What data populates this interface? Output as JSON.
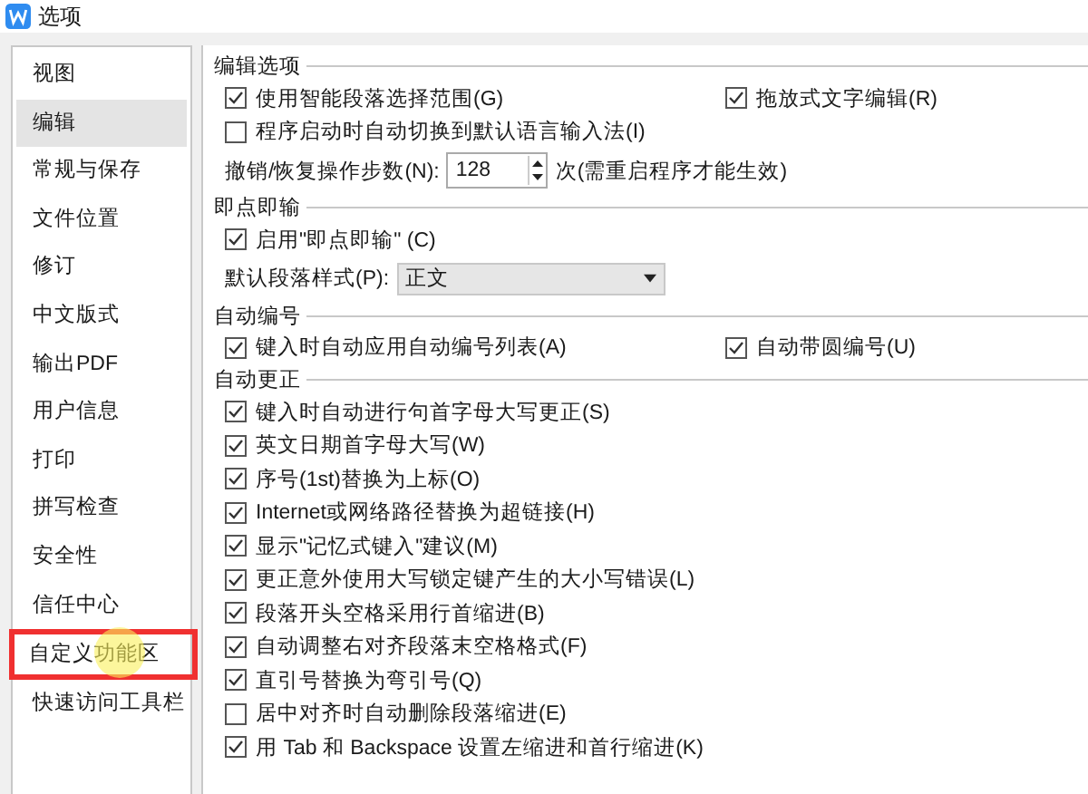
{
  "window": {
    "title": "选项"
  },
  "sidebar": {
    "items": [
      {
        "label": "视图",
        "selected": false,
        "highlighted": false
      },
      {
        "label": "编辑",
        "selected": true,
        "highlighted": false
      },
      {
        "label": "常规与保存",
        "selected": false,
        "highlighted": false
      },
      {
        "label": "文件位置",
        "selected": false,
        "highlighted": false
      },
      {
        "label": "修订",
        "selected": false,
        "highlighted": false
      },
      {
        "label": "中文版式",
        "selected": false,
        "highlighted": false
      },
      {
        "label": "输出PDF",
        "selected": false,
        "highlighted": false
      },
      {
        "label": "用户信息",
        "selected": false,
        "highlighted": false
      },
      {
        "label": "打印",
        "selected": false,
        "highlighted": false
      },
      {
        "label": "拼写检查",
        "selected": false,
        "highlighted": false
      },
      {
        "label": "安全性",
        "selected": false,
        "highlighted": false
      },
      {
        "label": "信任中心",
        "selected": false,
        "highlighted": false
      },
      {
        "label": "自定义功能区",
        "selected": false,
        "highlighted": true
      },
      {
        "label": "快速访问工具栏",
        "selected": false,
        "highlighted": false
      }
    ]
  },
  "sections": [
    {
      "title": "编辑选项",
      "rows": [
        {
          "kind": "pair",
          "items": [
            {
              "label": "使用智能段落选择范围(G)",
              "checked": true
            },
            {
              "label": "拖放式文字编辑(R)",
              "checked": true
            }
          ]
        },
        {
          "kind": "checkbox",
          "label": "程序启动时自动切换到默认语言输入法(I)",
          "checked": false
        },
        {
          "kind": "spinner",
          "label": "撤销/恢复操作步数(N):",
          "value": "128",
          "suffix": "次(需重启程序才能生效)"
        }
      ]
    },
    {
      "title": "即点即输",
      "rows": [
        {
          "kind": "checkbox",
          "label": "启用\"即点即输\" (C)",
          "checked": true
        },
        {
          "kind": "select",
          "label": "默认段落样式(P):",
          "value": "正文"
        }
      ]
    },
    {
      "title": "自动编号",
      "rows": [
        {
          "kind": "pair",
          "items": [
            {
              "label": "键入时自动应用自动编号列表(A)",
              "checked": true
            },
            {
              "label": "自动带圆编号(U)",
              "checked": true
            }
          ]
        }
      ]
    },
    {
      "title": "自动更正",
      "rows": [
        {
          "kind": "checkbox",
          "label": "键入时自动进行句首字母大写更正(S)",
          "checked": true
        },
        {
          "kind": "checkbox",
          "label": "英文日期首字母大写(W)",
          "checked": true
        },
        {
          "kind": "checkbox",
          "label": "序号(1st)替换为上标(O)",
          "checked": true
        },
        {
          "kind": "checkbox",
          "label": "Internet或网络路径替换为超链接(H)",
          "checked": true
        },
        {
          "kind": "checkbox",
          "label": "显示\"记忆式键入\"建议(M)",
          "checked": true
        },
        {
          "kind": "checkbox",
          "label": "更正意外使用大写锁定键产生的大小写错误(L)",
          "checked": true
        },
        {
          "kind": "checkbox",
          "label": "段落开头空格采用行首缩进(B)",
          "checked": true
        },
        {
          "kind": "checkbox",
          "label": "自动调整右对齐段落末空格格式(F)",
          "checked": true
        },
        {
          "kind": "checkbox",
          "label": "直引号替换为弯引号(Q)",
          "checked": true
        },
        {
          "kind": "checkbox",
          "label": "居中对齐时自动删除段落缩进(E)",
          "checked": false
        },
        {
          "kind": "checkbox",
          "label": "用 Tab 和 Backspace 设置左缩进和首行缩进(K)",
          "checked": true
        }
      ]
    }
  ]
}
